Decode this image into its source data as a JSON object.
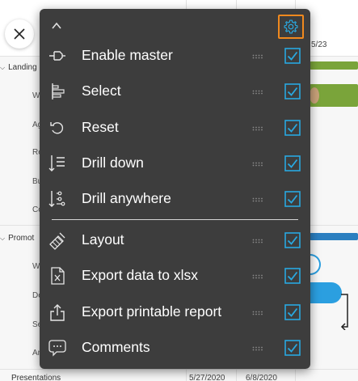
{
  "background": {
    "groups": [
      {
        "label": "Landing"
      },
      {
        "label": "Promot"
      },
      {
        "label": "Presentations"
      }
    ],
    "sub_rows": [
      "W",
      "Ag",
      "Re",
      "Bu",
      "Co",
      "W",
      "De",
      "Se",
      "An"
    ],
    "dates": {
      "header_partial": "5/23",
      "presentations_start": "5/27/2020",
      "presentations_end": "6/8/2020"
    }
  },
  "menu": {
    "collapse_icon": "chevron-up-icon",
    "settings_icon": "gear-icon",
    "accent_color": "#f0891e",
    "check_color": "#29a8e0",
    "items": [
      {
        "id": "enable-master",
        "label": "Enable master",
        "icon": "pin-icon",
        "checked": true
      },
      {
        "id": "select",
        "label": "Select",
        "icon": "select-icon",
        "checked": true
      },
      {
        "id": "reset",
        "label": "Reset",
        "icon": "reset-icon",
        "checked": true
      },
      {
        "id": "drill-down",
        "label": "Drill down",
        "icon": "drill-down-icon",
        "checked": true
      },
      {
        "id": "drill-anywhere",
        "label": "Drill anywhere",
        "icon": "drill-anywhere-icon",
        "checked": true
      },
      {
        "id": "layout",
        "label": "Layout",
        "icon": "layout-icon",
        "checked": true
      },
      {
        "id": "export-xlsx",
        "label": "Export data to xlsx",
        "icon": "excel-icon",
        "checked": true
      },
      {
        "id": "export-report",
        "label": "Export printable report",
        "icon": "share-icon",
        "checked": true
      },
      {
        "id": "comments",
        "label": "Comments",
        "icon": "comment-icon",
        "checked": true
      }
    ]
  }
}
